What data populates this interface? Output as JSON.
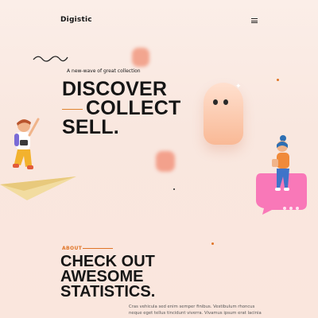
{
  "header": {
    "brand": "Digistic",
    "menu_icon": "hamburger-menu-icon"
  },
  "hero": {
    "tagline": "A new-wave of great collection",
    "line1": "DISCOVER",
    "line2": "COLLECT",
    "line3": "SELL."
  },
  "about": {
    "label": "ABOUT",
    "title_line1": "CHECK OUT",
    "title_line2": "AWESOME",
    "title_line3": "STATISTICS.",
    "text": "Cras vehicula sed enim semper finibus. Vestibulum rhoncus neque eget tellus tincidunt viverra. Vivamus ipsum erat lacinia"
  },
  "colors": {
    "accent": "#e07426",
    "background": "#fbeee8",
    "text": "#151515"
  }
}
